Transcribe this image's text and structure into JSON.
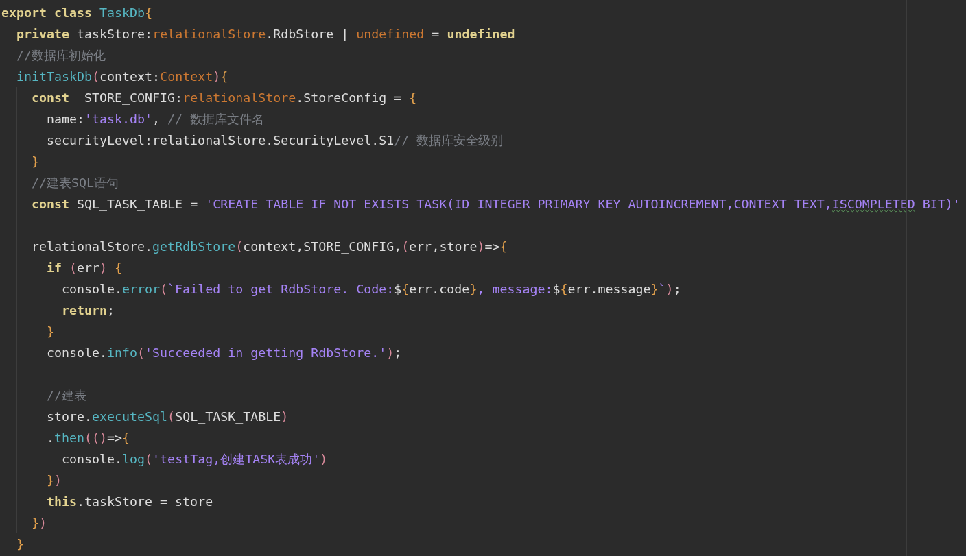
{
  "editor": {
    "lines": [
      {
        "kind": "code",
        "tokens": [
          {
            "kind": "keyword",
            "text": "export "
          },
          {
            "kind": "keyword",
            "text": "class "
          },
          {
            "kind": "class",
            "text": "TaskDb"
          },
          {
            "kind": "brace",
            "text": "{"
          }
        ],
        "children": [
          {
            "kind": "code",
            "tokens": [
              {
                "kind": "keyword",
                "text": "private "
              },
              {
                "kind": "plain",
                "text": "taskStore:"
              },
              {
                "kind": "type",
                "text": "relationalStore"
              },
              {
                "kind": "plain",
                "text": ".RdbStore | "
              },
              {
                "kind": "type",
                "text": "undefined"
              },
              {
                "kind": "plain",
                "text": " = "
              },
              {
                "kind": "keyword",
                "text": "undefined"
              }
            ]
          },
          {
            "kind": "code",
            "tokens": [
              {
                "kind": "comment",
                "text": "//数据库初始化"
              }
            ]
          },
          {
            "kind": "code",
            "tokens": [
              {
                "kind": "function",
                "text": "initTaskDb"
              },
              {
                "kind": "paren",
                "text": "("
              },
              {
                "kind": "plain",
                "text": "context:"
              },
              {
                "kind": "type",
                "text": "Context"
              },
              {
                "kind": "paren",
                "text": ")"
              },
              {
                "kind": "brace",
                "text": "{"
              }
            ],
            "children": [
              {
                "kind": "code",
                "tokens": [
                  {
                    "kind": "keyword",
                    "text": "const"
                  },
                  {
                    "kind": "plain",
                    "text": "  STORE_CONFIG:"
                  },
                  {
                    "kind": "type",
                    "text": "relationalStore"
                  },
                  {
                    "kind": "plain",
                    "text": ".StoreConfig = "
                  },
                  {
                    "kind": "brace",
                    "text": "{"
                  }
                ],
                "children": [
                  {
                    "kind": "code",
                    "tokens": [
                      {
                        "kind": "plain",
                        "text": "name:"
                      },
                      {
                        "kind": "string",
                        "text": "'task.db'"
                      },
                      {
                        "kind": "plain",
                        "text": ", "
                      },
                      {
                        "kind": "comment",
                        "text": "// 数据库文件名"
                      }
                    ]
                  },
                  {
                    "kind": "code",
                    "tokens": [
                      {
                        "kind": "plain",
                        "text": "securityLevel:relationalStore.SecurityLevel.S1"
                      },
                      {
                        "kind": "comment",
                        "text": "// 数据库安全级别"
                      }
                    ]
                  }
                ]
              },
              {
                "kind": "code",
                "tokens": [
                  {
                    "kind": "brace",
                    "text": "}"
                  }
                ]
              },
              {
                "kind": "code",
                "tokens": [
                  {
                    "kind": "comment",
                    "text": "//建表SQL语句"
                  }
                ]
              },
              {
                "kind": "code",
                "tokens": [
                  {
                    "kind": "keyword",
                    "text": "const"
                  },
                  {
                    "kind": "plain",
                    "text": " SQL_TASK_TABLE = "
                  },
                  {
                    "kind": "string",
                    "text": "'CREATE TABLE IF NOT EXISTS TASK(ID INTEGER PRIMARY KEY AUTOINCREMENT,CONTEXT TEXT,"
                  },
                  {
                    "kind": "misspelled",
                    "text": "ISCOMPLETED"
                  },
                  {
                    "kind": "string",
                    "text": " BIT)'"
                  }
                ]
              },
              {
                "kind": "blank"
              },
              {
                "kind": "code",
                "tokens": [
                  {
                    "kind": "plain",
                    "text": "relationalStore."
                  },
                  {
                    "kind": "function",
                    "text": "getRdbStore"
                  },
                  {
                    "kind": "paren",
                    "text": "("
                  },
                  {
                    "kind": "plain",
                    "text": "context,STORE_CONFIG,"
                  },
                  {
                    "kind": "paren",
                    "text": "("
                  },
                  {
                    "kind": "plain",
                    "text": "err,store"
                  },
                  {
                    "kind": "paren",
                    "text": ")"
                  },
                  {
                    "kind": "plain",
                    "text": "=>"
                  },
                  {
                    "kind": "brace",
                    "text": "{"
                  }
                ],
                "children": [
                  {
                    "kind": "code",
                    "tokens": [
                      {
                        "kind": "keyword",
                        "text": "if "
                      },
                      {
                        "kind": "paren",
                        "text": "("
                      },
                      {
                        "kind": "plain",
                        "text": "err"
                      },
                      {
                        "kind": "paren",
                        "text": ")"
                      },
                      {
                        "kind": "brace",
                        "text": " {"
                      }
                    ],
                    "children": [
                      {
                        "kind": "code",
                        "tokens": [
                          {
                            "kind": "plain",
                            "text": "console."
                          },
                          {
                            "kind": "function",
                            "text": "error"
                          },
                          {
                            "kind": "paren",
                            "text": "("
                          },
                          {
                            "kind": "string",
                            "text": "`Failed to get RdbStore. Code:"
                          },
                          {
                            "kind": "plain",
                            "text": "$"
                          },
                          {
                            "kind": "brace",
                            "text": "{"
                          },
                          {
                            "kind": "plain",
                            "text": "err.code"
                          },
                          {
                            "kind": "brace",
                            "text": "}"
                          },
                          {
                            "kind": "string",
                            "text": ", message:"
                          },
                          {
                            "kind": "plain",
                            "text": "$"
                          },
                          {
                            "kind": "brace",
                            "text": "{"
                          },
                          {
                            "kind": "plain",
                            "text": "err.message"
                          },
                          {
                            "kind": "brace",
                            "text": "}"
                          },
                          {
                            "kind": "string",
                            "text": "`"
                          },
                          {
                            "kind": "paren",
                            "text": ")"
                          },
                          {
                            "kind": "plain",
                            "text": ";"
                          }
                        ]
                      },
                      {
                        "kind": "code",
                        "tokens": [
                          {
                            "kind": "keyword",
                            "text": "return"
                          },
                          {
                            "kind": "plain",
                            "text": ";"
                          }
                        ]
                      }
                    ]
                  },
                  {
                    "kind": "code",
                    "tokens": [
                      {
                        "kind": "brace",
                        "text": "}"
                      }
                    ]
                  },
                  {
                    "kind": "code",
                    "tokens": [
                      {
                        "kind": "plain",
                        "text": "console."
                      },
                      {
                        "kind": "function",
                        "text": "info"
                      },
                      {
                        "kind": "paren",
                        "text": "("
                      },
                      {
                        "kind": "string",
                        "text": "'Succeeded in getting RdbStore.'"
                      },
                      {
                        "kind": "paren",
                        "text": ")"
                      },
                      {
                        "kind": "plain",
                        "text": ";"
                      }
                    ]
                  },
                  {
                    "kind": "blank"
                  },
                  {
                    "kind": "code",
                    "tokens": [
                      {
                        "kind": "comment",
                        "text": "//建表"
                      }
                    ]
                  },
                  {
                    "kind": "code",
                    "tokens": [
                      {
                        "kind": "plain",
                        "text": "store."
                      },
                      {
                        "kind": "function",
                        "text": "executeSql"
                      },
                      {
                        "kind": "paren",
                        "text": "("
                      },
                      {
                        "kind": "plain",
                        "text": "SQL_TASK_TABLE"
                      },
                      {
                        "kind": "paren",
                        "text": ")"
                      }
                    ]
                  },
                  {
                    "kind": "code",
                    "tokens": [
                      {
                        "kind": "plain",
                        "text": "."
                      },
                      {
                        "kind": "function",
                        "text": "then"
                      },
                      {
                        "kind": "paren",
                        "text": "(()"
                      },
                      {
                        "kind": "plain",
                        "text": "=>"
                      },
                      {
                        "kind": "brace",
                        "text": "{"
                      }
                    ],
                    "children": [
                      {
                        "kind": "code",
                        "tokens": [
                          {
                            "kind": "plain",
                            "text": "console."
                          },
                          {
                            "kind": "function",
                            "text": "log"
                          },
                          {
                            "kind": "paren",
                            "text": "("
                          },
                          {
                            "kind": "string",
                            "text": "'testTag,创建TASK表成功'"
                          },
                          {
                            "kind": "paren",
                            "text": ")"
                          }
                        ]
                      }
                    ]
                  },
                  {
                    "kind": "code",
                    "tokens": [
                      {
                        "kind": "brace",
                        "text": "}"
                      },
                      {
                        "kind": "paren",
                        "text": ")"
                      }
                    ]
                  },
                  {
                    "kind": "code",
                    "tokens": [
                      {
                        "kind": "keyword",
                        "text": "this"
                      },
                      {
                        "kind": "plain",
                        "text": ".taskStore = store"
                      }
                    ]
                  }
                ]
              },
              {
                "kind": "code",
                "tokens": [
                  {
                    "kind": "brace",
                    "text": "}"
                  },
                  {
                    "kind": "paren",
                    "text": ")"
                  }
                ]
              }
            ]
          },
          {
            "kind": "code",
            "tokens": [
              {
                "kind": "brace",
                "text": "}"
              }
            ]
          }
        ]
      }
    ]
  }
}
